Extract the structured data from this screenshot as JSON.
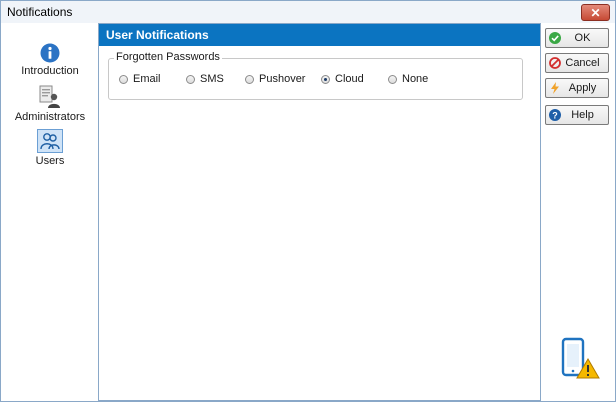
{
  "window": {
    "title": "Notifications"
  },
  "sidebar": {
    "items": [
      {
        "label": "Introduction",
        "icon": "info-icon"
      },
      {
        "label": "Administrators",
        "icon": "administrators-icon"
      },
      {
        "label": "Users",
        "icon": "users-icon",
        "selected": true
      }
    ]
  },
  "panel": {
    "title": "User Notifications",
    "group_label": "Forgotten Passwords",
    "options": [
      {
        "label": "Email",
        "checked": false
      },
      {
        "label": "SMS",
        "checked": false
      },
      {
        "label": "Pushover",
        "checked": false
      },
      {
        "label": "Cloud",
        "checked": true
      },
      {
        "label": "None",
        "checked": false
      }
    ]
  },
  "buttons": {
    "ok": "OK",
    "cancel": "Cancel",
    "apply": "Apply",
    "help": "Help"
  },
  "colors": {
    "header_blue": "#0b74c1",
    "ok_green": "#3aa845",
    "cancel_red": "#d32f2f",
    "apply_orange": "#f0a22a",
    "help_blue": "#1f5fa8",
    "warning_yellow": "#f5b800"
  }
}
